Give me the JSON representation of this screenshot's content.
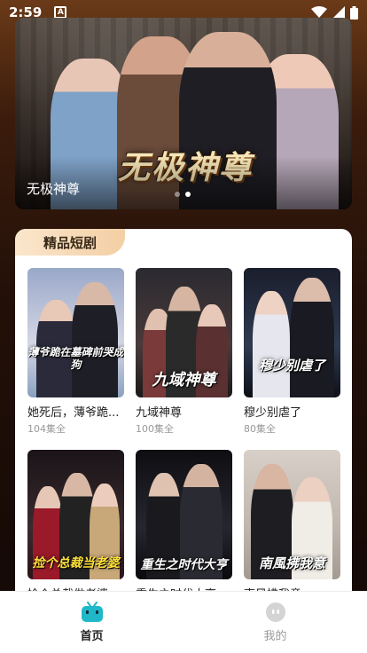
{
  "status_bar": {
    "time": "2:59",
    "notif_letter": "A"
  },
  "banner": {
    "title_art": "无极神尊",
    "caption": "无极神尊"
  },
  "section": {
    "title": "精品短剧"
  },
  "dramas": [
    {
      "name": "她死后，薄爷跪...",
      "episodes": "104集全",
      "poster_text": "薄爷跪在墓碑前哭成狗"
    },
    {
      "name": "九域神尊",
      "episodes": "100集全",
      "poster_text": "九域神尊"
    },
    {
      "name": "穆少别虐了",
      "episodes": "80集全",
      "poster_text": "穆少别虐了"
    },
    {
      "name": "捡个总裁做老婆",
      "episodes": "",
      "poster_text": "捡个总裁当老婆"
    },
    {
      "name": "重生之时代大亨",
      "episodes": "",
      "poster_text": "重生之时代大亨"
    },
    {
      "name": "南风拂我意",
      "episodes": "",
      "poster_text": "南風拂我意"
    }
  ],
  "nav": {
    "home": "首页",
    "mine": "我的"
  },
  "colors": {
    "accent_tab": "#f3cfa4",
    "home_icon": "#1fb8c8"
  }
}
